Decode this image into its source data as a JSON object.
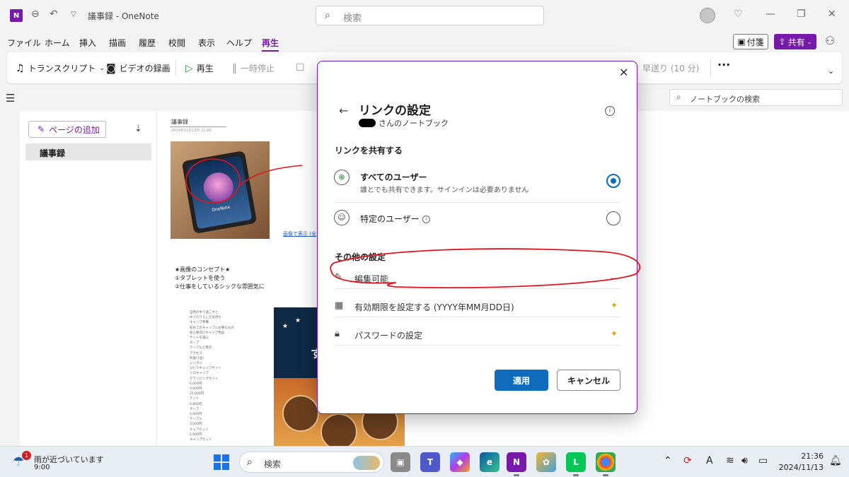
{
  "window": {
    "app_logo": "N",
    "title": "議事録  -  OneNote",
    "search_placeholder": "検索"
  },
  "menu": {
    "items": [
      "ファイル",
      "ホーム",
      "挿入",
      "描画",
      "履歴",
      "校閲",
      "表示",
      "ヘルプ",
      "再生"
    ],
    "active": "再生",
    "sticky_label": "付箋",
    "share_label": "共有"
  },
  "ribbon": {
    "transcript": "トランスクリプト",
    "video_record": "ビデオの録画",
    "play": "再生",
    "pause": "一時停止",
    "fast_forward": "早送り (10 分)"
  },
  "notebook_search": "ノートブックの検索",
  "page_list": {
    "add_page": "ページの追加",
    "pages": [
      "議事録"
    ]
  },
  "note": {
    "title": "議事録",
    "date": "2024年11月13日    21:00",
    "image_label": "OneNote",
    "image_link": "画像で表示 (全",
    "concept": [
      "★画像のコンセプト★",
      "①タブレットを使う",
      "②仕事をしているシックな雰囲気に"
    ],
    "list_lines": [
      "自然の中で過ごすと",
      "ゆったりとした気持ち",
      "キャンプ準備",
      "初めてのキャンプに必要なもの",
      "初心者向けキャンプ用品",
      "テントを選ぶ",
      "タープ",
      "テーブルと椅子",
      "アクセス",
      "料金(1泊)",
      "レンタル",
      "ひとりキャンプサイト",
      "ソロキャンプ",
      "グランピングサイト",
      "6,000円",
      "3,900円",
      "25,000円",
      "テント",
      "6,800円",
      "タープ",
      "4,000円",
      "テーブル",
      "3,000円",
      "チェアセット",
      "2,600円",
      "キャンプセット"
    ],
    "poster_text": "すキ"
  },
  "dialog": {
    "title": "リンクの設定",
    "owner": "さんのノートブック",
    "share_section": "リンクを共有する",
    "option_all_title": "すべてのユーザー",
    "option_all_desc": "誰とでも共有できます。サインインは必要ありません",
    "option_specific_title": "特定のユーザー",
    "selected": "all",
    "other_section": "その他の設定",
    "permission": "編集可能",
    "expiry": "有効期限を設定する (YYYY年MM月DD日)",
    "password": "パスワードの設定",
    "apply": "適用",
    "cancel": "キャンセル"
  },
  "taskbar": {
    "notification_count": "1",
    "weather_title": "雨が近づいています",
    "weather_time": "9:00",
    "search_label": "検索",
    "time": "21:36",
    "date": "2024/11/13"
  },
  "colors": {
    "onenote_purple": "#7719aa",
    "accent_blue": "#0f6cbd",
    "ink_red": "#e0141e"
  }
}
